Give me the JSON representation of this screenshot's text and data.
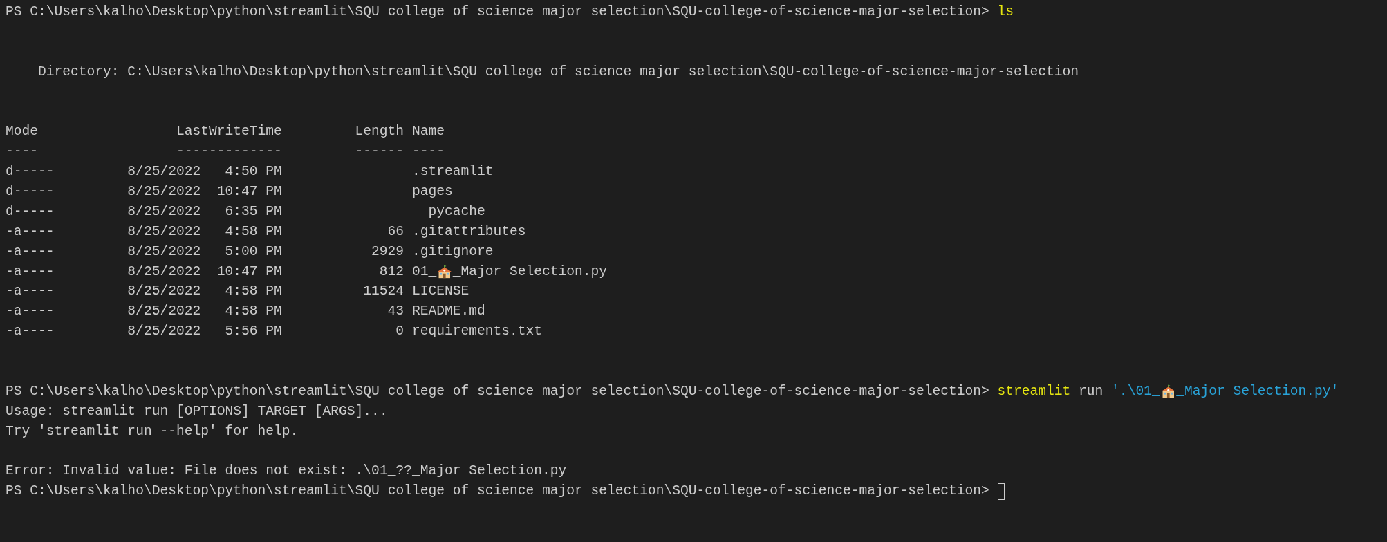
{
  "first_prompt": {
    "path": "PS C:\\Users\\kalho\\Desktop\\python\\streamlit\\SQU college of science major selection\\SQU-college-of-science-major-selection>",
    "command": [
      {
        "kind": "command",
        "parts": [
          "ls"
        ]
      }
    ]
  },
  "directory": "Directory: C:\\Users\\kalho\\Desktop\\python\\streamlit\\SQU college of science major selection\\SQU-college-of-science-major-selection",
  "table": {
    "columns": [
      "Mode",
      "LastWriteTime",
      "Length",
      "Name"
    ],
    "separators": [
      "----",
      "-------------",
      "------",
      "----"
    ],
    "rows": [
      {
        "mode": "d-----",
        "last_write_time": "8/25/2022   4:50 PM",
        "name_parts": [
          ".streamlit"
        ]
      },
      {
        "mode": "d-----",
        "last_write_time": "8/25/2022  10:47 PM",
        "name_parts": [
          "pages"
        ]
      },
      {
        "mode": "d-----",
        "last_write_time": "8/25/2022   6:35 PM",
        "name_parts": [
          "__pycache__"
        ]
      },
      {
        "mode": "-a----",
        "last_write_time": "8/25/2022   4:58 PM",
        "length": "66",
        "name_parts": [
          ".gitattributes"
        ]
      },
      {
        "mode": "-a----",
        "last_write_time": "8/25/2022   5:00 PM",
        "length": "2929",
        "name_parts": [
          ".gitignore"
        ]
      },
      {
        "mode": "-a----",
        "last_write_time": "8/25/2022  10:47 PM",
        "length": "812",
        "name_parts": [
          "01_",
          "_Major Selection.py"
        ]
      },
      {
        "mode": "-a----",
        "last_write_time": "8/25/2022   4:58 PM",
        "length": "11524",
        "name_parts": [
          "LICENSE"
        ]
      },
      {
        "mode": "-a----",
        "last_write_time": "8/25/2022   4:58 PM",
        "length": "43",
        "name_parts": [
          "README.md"
        ]
      },
      {
        "mode": "-a----",
        "last_write_time": "8/25/2022   5:56 PM",
        "length": "0",
        "name_parts": [
          "requirements.txt"
        ]
      }
    ]
  },
  "second_prompt": {
    "path": "PS C:\\Users\\kalho\\Desktop\\python\\streamlit\\SQU college of science major selection\\SQU-college-of-science-major-selection>",
    "command": [
      {
        "kind": "command",
        "parts": [
          "streamlit"
        ]
      },
      {
        "kind": "plain",
        "parts": [
          "run"
        ]
      },
      {
        "kind": "string",
        "parts": [
          "'.\\01_",
          "_Major Selection.py'"
        ]
      }
    ]
  },
  "usage_lines": [
    "Usage: streamlit run [OPTIONS] TARGET [ARGS]...",
    "Try 'streamlit run --help' for help."
  ],
  "error": "Error: Invalid value: File does not exist: .\\01_??_Major Selection.py",
  "last_prompt": {
    "path": "PS C:\\Users\\kalho\\Desktop\\python\\streamlit\\SQU college of science major selection\\SQU-college-of-science-major-selection>"
  }
}
